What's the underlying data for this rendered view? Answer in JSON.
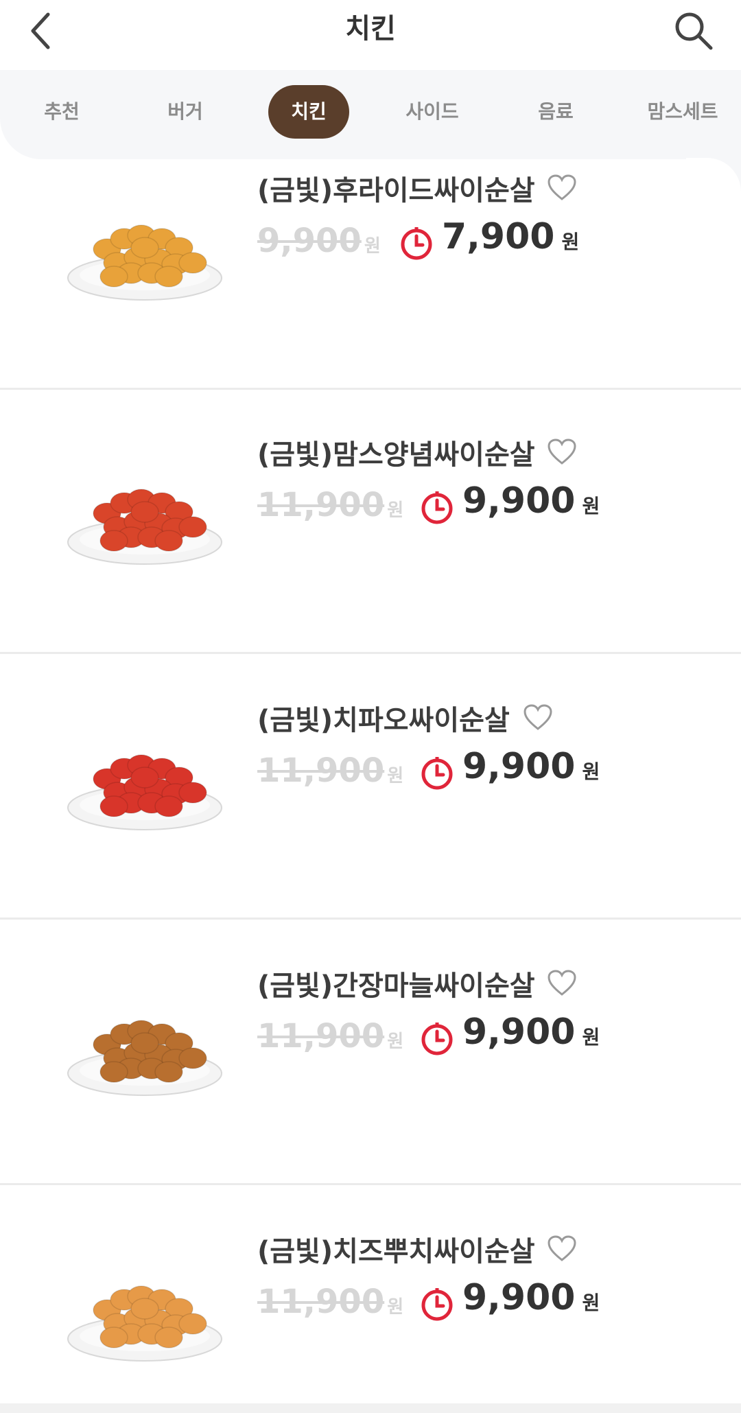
{
  "header": {
    "title": "치킨"
  },
  "tabs": [
    {
      "label": "추천"
    },
    {
      "label": "버거"
    },
    {
      "label": "치킨",
      "active": true
    },
    {
      "label": "사이드"
    },
    {
      "label": "음료"
    },
    {
      "label": "맘스세트"
    }
  ],
  "items": [
    {
      "name": "(금빛)후라이드싸이순살",
      "old_price": "9,900",
      "old_unit": "원",
      "new_price": "7,900",
      "new_unit": "원",
      "color": "#e8a23a"
    },
    {
      "name": "(금빛)맘스양념싸이순살",
      "old_price": "11,900",
      "old_unit": "원",
      "new_price": "9,900",
      "new_unit": "원",
      "color": "#d9452a"
    },
    {
      "name": "(금빛)치파오싸이순살",
      "old_price": "11,900",
      "old_unit": "원",
      "new_price": "9,900",
      "new_unit": "원",
      "color": "#d8352a"
    },
    {
      "name": "(금빛)간장마늘싸이순살",
      "old_price": "11,900",
      "old_unit": "원",
      "new_price": "9,900",
      "new_unit": "원",
      "color": "#b86f2f"
    },
    {
      "name": "(금빛)치즈뿌치싸이순살",
      "old_price": "11,900",
      "old_unit": "원",
      "new_price": "9,900",
      "new_unit": "원",
      "color": "#e69a48"
    }
  ],
  "colors": {
    "accent_brown": "#5a3e2b",
    "timer_red": "#e0253a"
  }
}
